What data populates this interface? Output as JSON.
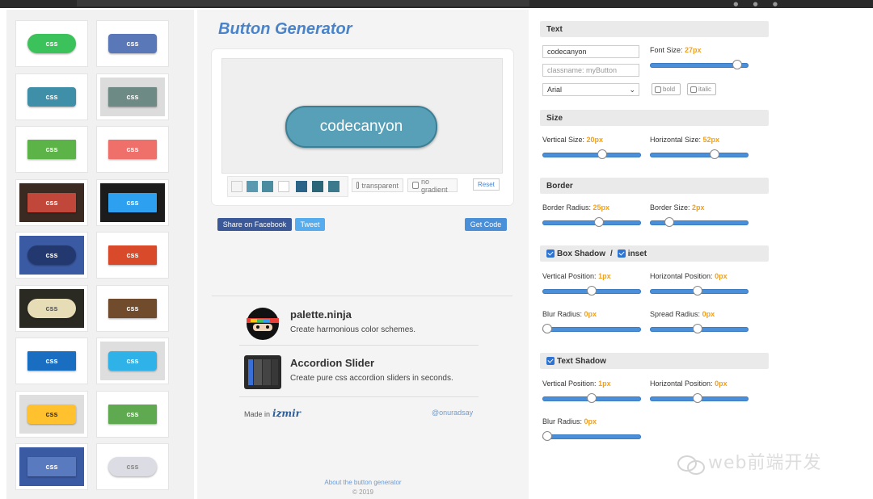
{
  "app": {
    "title": "Button Generator"
  },
  "gallery": {
    "tiles": [
      {
        "label": "css",
        "bg": "#ffffff",
        "btn": "#3cc25a",
        "text": "#ffffff",
        "shape": "pill"
      },
      {
        "label": "css",
        "bg": "#ffffff",
        "btn": "#5a78b8",
        "text": "#ffffff",
        "shape": "soft"
      },
      {
        "label": "css",
        "bg": "#ffffff",
        "btn": "#3f8fa8",
        "text": "#ffffff",
        "shape": "soft"
      },
      {
        "label": "css",
        "bg": "#dcdcdc",
        "btn": "#6e8a84",
        "text": "#ffffff",
        "shape": "flat"
      },
      {
        "label": "css",
        "bg": "#ffffff",
        "btn": "#5cb347",
        "text": "#ffffff",
        "shape": "flat"
      },
      {
        "label": "css",
        "bg": "#ffffff",
        "btn": "#ef6f6a",
        "text": "#ffffff",
        "shape": "flat"
      },
      {
        "label": "css",
        "bg": "#3a2a22",
        "btn": "#c0473a",
        "text": "#ffffff",
        "shape": "flat"
      },
      {
        "label": "css",
        "bg": "#1c1c1c",
        "btn": "#2ea0f0",
        "text": "#ffffff",
        "shape": "flat"
      },
      {
        "label": "css",
        "bg": "#3a5aa4",
        "btn": "#23386e",
        "text": "#ffffff",
        "shape": "pill"
      },
      {
        "label": "css",
        "bg": "#ffffff",
        "btn": "#d84a2a",
        "text": "#ffffff",
        "shape": "flat"
      },
      {
        "label": "css",
        "bg": "#2a2a22",
        "btn": "#e6dcb6",
        "text": "#555555",
        "shape": "pill"
      },
      {
        "label": "css",
        "bg": "#ffffff",
        "btn": "#704c2c",
        "text": "#ffffff",
        "shape": "flat"
      },
      {
        "label": "css",
        "bg": "#ffffff",
        "btn": "#1a6ec2",
        "text": "#ffffff",
        "shape": "flat"
      },
      {
        "label": "css",
        "bg": "#dedede",
        "btn": "#2eb2e8",
        "text": "#ffffff",
        "shape": "soft"
      },
      {
        "label": "css",
        "bg": "#dedede",
        "btn": "#ffc12e",
        "text": "#333333",
        "shape": "soft"
      },
      {
        "label": "css",
        "bg": "#ffffff",
        "btn": "#5faa50",
        "text": "#ffffff",
        "shape": "flat"
      },
      {
        "label": "css",
        "bg": "#3a5aa4",
        "btn": "#5a7ac0",
        "text": "#ffffff",
        "shape": "flat"
      },
      {
        "label": "css",
        "bg": "#ffffff",
        "btn": "#dcdce4",
        "text": "#888888",
        "shape": "pill"
      }
    ]
  },
  "preview": {
    "button_text": "codecanyon",
    "button_color": "#58a0b7",
    "border_color": "#3d7f94",
    "swatches": [
      "#f4f4f4",
      "#5a9ab0",
      "#4a8ca0",
      "#ffffff",
      "#2a6488",
      "#2a6678",
      "#3a7a8c"
    ],
    "transparent_label": "transparent",
    "no_gradient_label": "no gradient",
    "reset_label": "Reset"
  },
  "actions": {
    "facebook_label": "Share on Facebook",
    "tweet_label": "Tweet",
    "getcode_label": "Get Code"
  },
  "promos": [
    {
      "title": "palette.ninja",
      "desc": "Create harmonious color schemes."
    },
    {
      "title": "Accordion Slider",
      "desc": "Create pure css accordion sliders in seconds."
    }
  ],
  "footer": {
    "made_in": "Made in",
    "made_logo": "izmir",
    "handle": "@onuradsay",
    "about": "About the button generator",
    "copyright": "© 2019"
  },
  "settings": {
    "text": {
      "title": "Text",
      "value": "codecanyon",
      "classname_placeholder": "classname: myButton",
      "font_family": "Arial",
      "bold_label": "bold",
      "italic_label": "italic",
      "font_size_label": "Font Size:",
      "font_size": "27px",
      "font_size_level": 0.93
    },
    "size": {
      "title": "Size",
      "vertical_label": "Vertical Size:",
      "vertical": "20px",
      "vertical_level": 0.62,
      "horizontal_label": "Horizontal Size:",
      "horizontal": "52px",
      "horizontal_level": 0.67
    },
    "border": {
      "title": "Border",
      "radius_label": "Border Radius:",
      "radius": "25px",
      "radius_level": 0.58,
      "size_label": "Border Size:",
      "size": "2px",
      "size_level": 0.16
    },
    "box_shadow": {
      "title": "Box Shadow",
      "separator": "/",
      "inset_label": "inset",
      "vpos_label": "Vertical Position:",
      "vpos": "1px",
      "vpos_level": 0.5,
      "hpos_label": "Horizontal Position:",
      "hpos": "0px",
      "hpos_level": 0.48,
      "blur_label": "Blur Radius:",
      "blur": "0px",
      "blur_level": 0.0,
      "spread_label": "Spread Radius:",
      "spread": "0px",
      "spread_level": 0.48
    },
    "text_shadow": {
      "title": "Text Shadow",
      "vpos_label": "Vertical Position:",
      "vpos": "1px",
      "vpos_level": 0.5,
      "hpos_label": "Horizontal Position:",
      "hpos": "0px",
      "hpos_level": 0.48,
      "blur_label": "Blur Radius:",
      "blur": "0px",
      "blur_level": 0.0
    }
  },
  "watermark": "web前端开发"
}
